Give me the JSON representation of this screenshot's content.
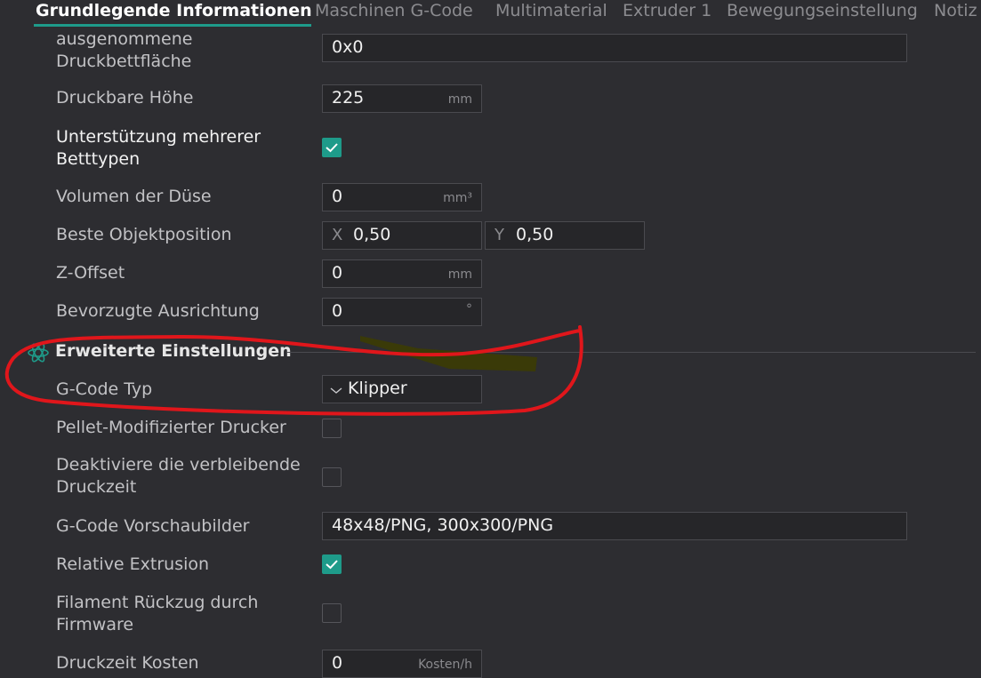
{
  "tabs": [
    {
      "label": "Grundlegende Informationen",
      "active": true
    },
    {
      "label": "Maschinen G-Code",
      "active": false
    },
    {
      "label": "Multimaterial",
      "active": false
    },
    {
      "label": "Extruder 1",
      "active": false
    },
    {
      "label": "Bewegungseinstellung",
      "active": false
    },
    {
      "label": "Notiz",
      "active": false
    }
  ],
  "rows": {
    "excluded_bed": {
      "label": "ausgenommene Druckbettfläche",
      "value": "0x0"
    },
    "printable_height": {
      "label": "Druckbare Höhe",
      "value": "225",
      "unit": "mm"
    },
    "multi_bed": {
      "label": "Unterstützung mehrerer Betttypen",
      "checked": true
    },
    "nozzle_volume": {
      "label": "Volumen der Düse",
      "value": "0",
      "unit": "mm³"
    },
    "best_position": {
      "label": "Beste Objektposition",
      "x_axis": "X",
      "x_value": "0,50",
      "y_axis": "Y",
      "y_value": "0,50"
    },
    "z_offset": {
      "label": "Z-Offset",
      "value": "0",
      "unit": "mm"
    },
    "orientation": {
      "label": "Bevorzugte Ausrichtung",
      "value": "0",
      "unit": "°"
    }
  },
  "advanced": {
    "title": "Erweiterte Einstellungen",
    "gcode_type": {
      "label": "G-Code Typ",
      "value": "Klipper"
    },
    "pellet": {
      "label": "Pellet-Modifizierter Drucker",
      "checked": false
    },
    "disable_remaining": {
      "label": "Deaktiviere die verbleibende Druckzeit",
      "checked": false
    },
    "thumbnails": {
      "label": "G-Code Vorschaubilder",
      "value": "48x48/PNG, 300x300/PNG"
    },
    "relative_extrusion": {
      "label": "Relative Extrusion",
      "checked": true
    },
    "firmware_retraction": {
      "label": "Filament Rückzug durch Firmware",
      "checked": false
    },
    "time_cost": {
      "label": "Druckzeit Kosten",
      "value": "0",
      "unit": "Kosten/h"
    }
  },
  "colors": {
    "accent": "#1e9b8a",
    "annotation_red": "#e0161b",
    "highlight_olive": "#3a3a08"
  },
  "icons": {
    "section": "atom-icon",
    "checked": "checkmark-icon",
    "dropdown": "chevron-down-icon"
  }
}
